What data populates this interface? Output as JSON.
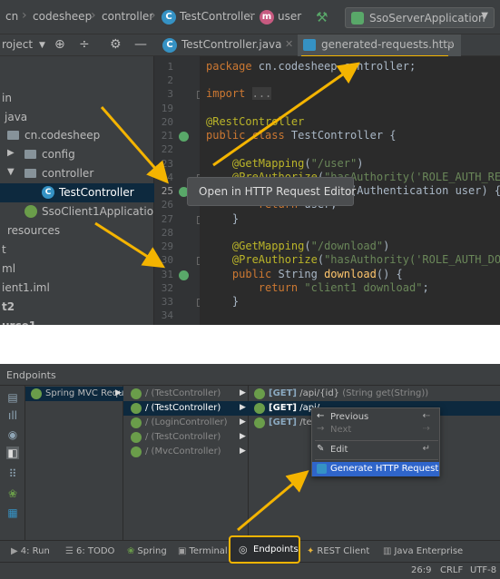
{
  "navbar": {
    "breadcrumbs": [
      "cn",
      "codesheep",
      "controller",
      "TestController",
      "user"
    ],
    "run_config": "SsoServerApplication"
  },
  "project": {
    "title": "roject",
    "tree": [
      {
        "label": "in"
      },
      {
        "label": "java"
      },
      {
        "label": "cn.codesheep"
      },
      {
        "label": "config"
      },
      {
        "label": "controller"
      },
      {
        "label": "TestController"
      },
      {
        "label": "SsoClient1Application"
      },
      {
        "label": "resources"
      },
      {
        "label": "t"
      },
      {
        "label": "ml"
      },
      {
        "label": "ient1.iml"
      },
      {
        "label": "t2"
      },
      {
        "label": "urce1"
      }
    ]
  },
  "tabs": [
    {
      "label": "TestController.java"
    },
    {
      "label": "generated-requests.http"
    }
  ],
  "editor": {
    "line_numbers": [
      "1",
      "2",
      "3",
      "19",
      "20",
      "21",
      "22",
      "23",
      "24",
      "25",
      "26",
      "27",
      "28",
      "29",
      "30",
      "31",
      "32",
      "33",
      "34"
    ]
  },
  "tooltip": {
    "text": "Open in HTTP Request Editor"
  },
  "endpoints": {
    "title": "Endpoints",
    "framework": "Spring MVC Requ",
    "controllers": [
      "/ (TestController)",
      "/ (TestController)",
      "/ (LoginController)",
      "/ (TestController)",
      "/ (MvcController)"
    ],
    "requests": [
      {
        "method": "[GET]",
        "path": "/api/{id}",
        "sig": "(String get(String))"
      },
      {
        "method": "[GET]",
        "path": "/api/",
        "sig": ""
      },
      {
        "method": "[GET]",
        "path": "/tes",
        "sig": ""
      }
    ],
    "menu": {
      "previous": "Previous",
      "next": "Next",
      "edit": "Edit",
      "generate": "Generate HTTP Request"
    }
  },
  "toolwindows": {
    "run": "4: Run",
    "todo": "6: TODO",
    "spring": "Spring",
    "terminal": "Terminal",
    "endpoints": "Endpoints",
    "rest": "REST Client",
    "javaee": "Java Enterprise"
  },
  "status": {
    "position": "26:9",
    "line_sep": "CRLF",
    "encoding": "UTF-8"
  },
  "colors": {
    "highlight": "#f4b400",
    "selection": "#2f65ca"
  }
}
